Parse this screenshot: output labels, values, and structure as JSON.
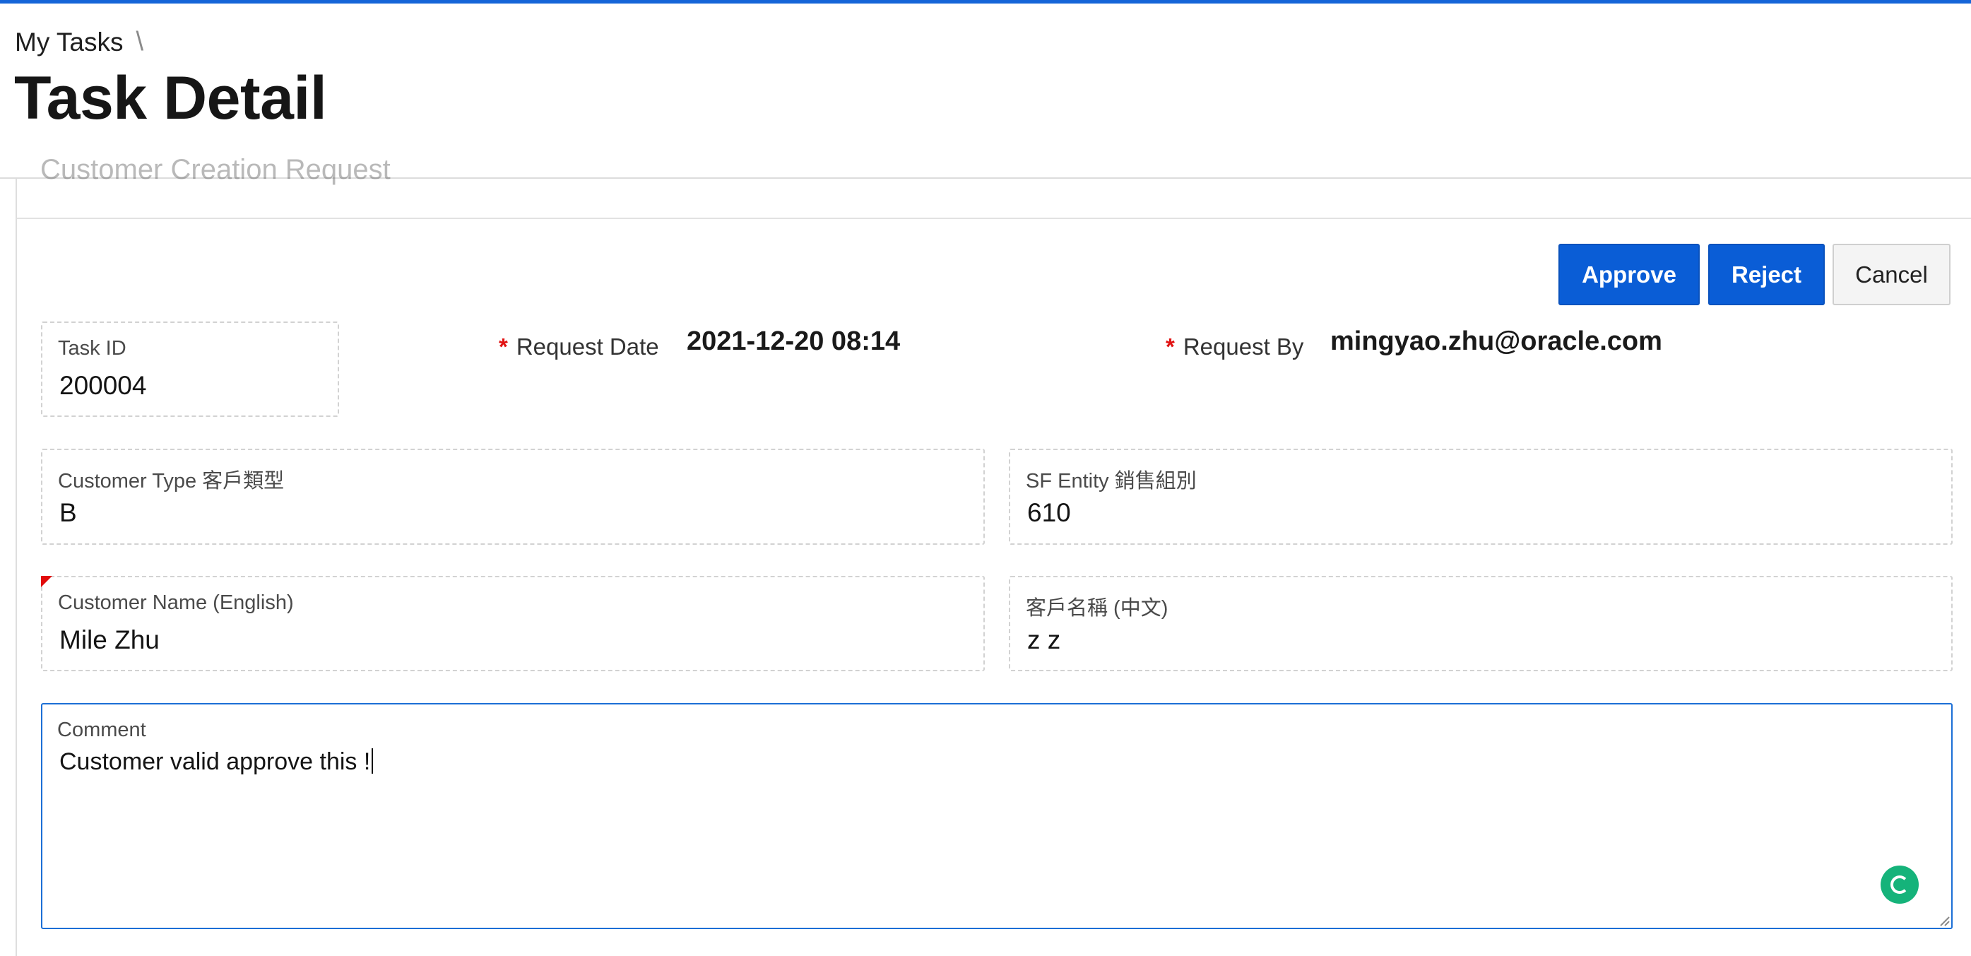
{
  "breadcrumb": {
    "items": [
      "My Tasks"
    ],
    "separator": "\\"
  },
  "page": {
    "title": "Task Detail",
    "card_title": "Customer Creation Request"
  },
  "actions": {
    "approve": "Approve",
    "reject": "Reject",
    "cancel": "Cancel"
  },
  "fields": {
    "task_id": {
      "label": "Task ID",
      "value": "200004"
    },
    "request_date": {
      "label": "Request Date",
      "value": "2021-12-20 08:14",
      "required_mark": "*"
    },
    "request_by": {
      "label": "Request By",
      "value": "mingyao.zhu@oracle.com",
      "required_mark": "*"
    },
    "customer_type": {
      "label": "Customer Type 客戶類型",
      "value": "B"
    },
    "sf_entity": {
      "label": "SF Entity 銷售組別",
      "value": "610"
    },
    "customer_name_en": {
      "label": "Customer Name (English)",
      "value": "Mile Zhu"
    },
    "customer_name_zh": {
      "label": "客戶名稱 (中文)",
      "value": "z z"
    },
    "comment": {
      "label": "Comment",
      "value": "Customer valid approve this !"
    }
  },
  "colors": {
    "accent": "#0a5dd6",
    "required": "#e11414",
    "grammar_badge": "#15b37a"
  },
  "icons": {
    "grammar_assistant": "grammar-check-icon",
    "resize_handle": "resize-handle-icon",
    "error_flag": "error-flag-icon"
  }
}
